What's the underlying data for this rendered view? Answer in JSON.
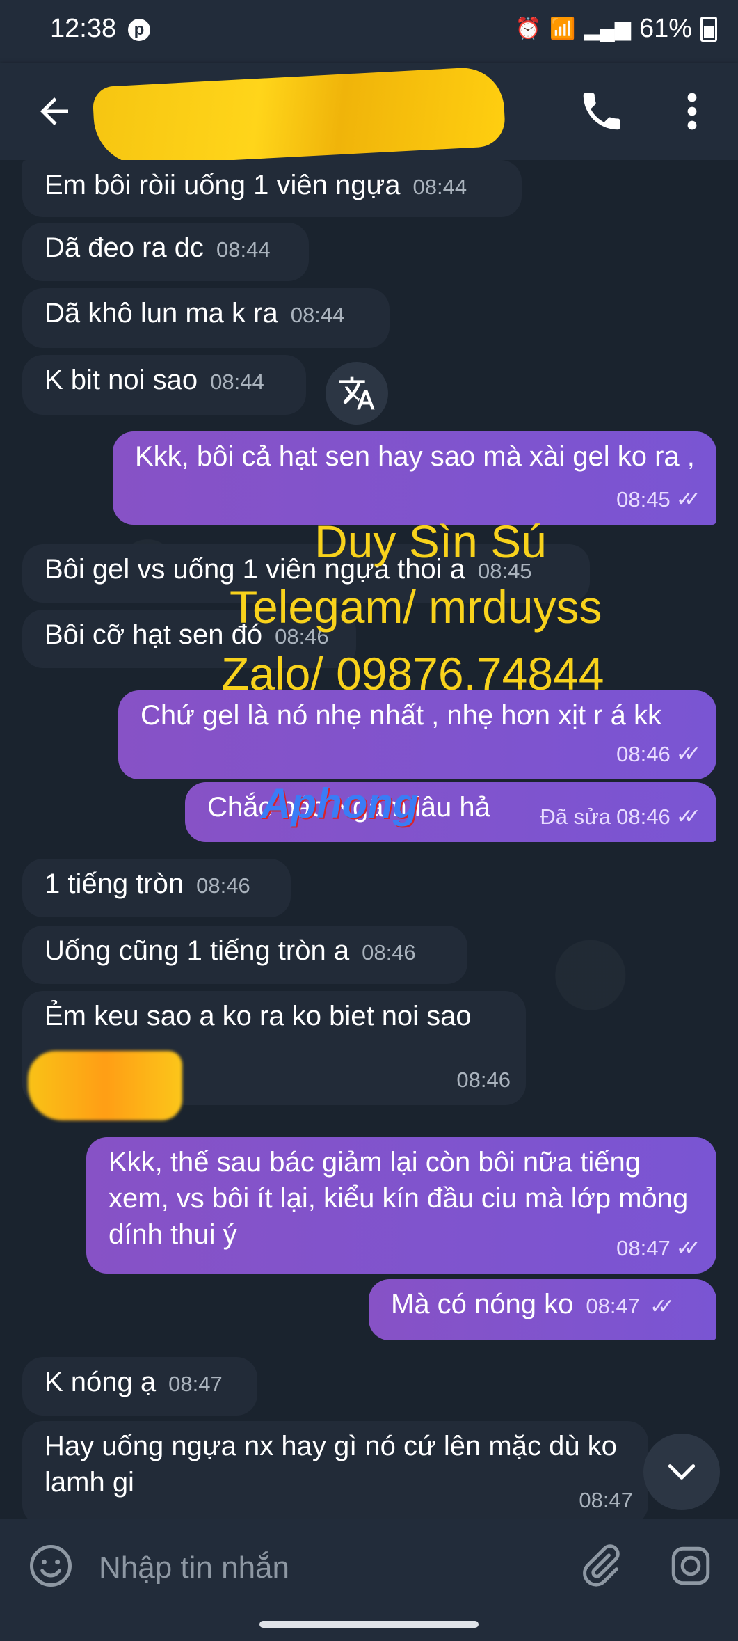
{
  "status_bar": {
    "time": "12:38",
    "battery": "61%"
  },
  "header": {
    "contact_name_redacted": true
  },
  "messages": [
    {
      "dir": "in",
      "text": "Em bôi ròii uống 1 viên ngựa",
      "time": "08:44"
    },
    {
      "dir": "in",
      "text": "Dã đeo ra dc",
      "time": "08:44"
    },
    {
      "dir": "in",
      "text": "Dã khô lun ma k ra",
      "time": "08:44"
    },
    {
      "dir": "in",
      "text": "K bit noi sao",
      "time": "08:44"
    },
    {
      "dir": "out",
      "text": "Kkk, bôi cả hạt sen hay sao mà xài gel ko ra ,",
      "time": "08:45"
    },
    {
      "dir": "in",
      "text": "Bôi gel vs uống 1 viên ngựa thoi a",
      "time": "08:45"
    },
    {
      "dir": "in",
      "text": "Bôi cỡ hạt sen đó",
      "time": "08:46"
    },
    {
      "dir": "out",
      "text": "Chứ gel là nó nhẹ nhất , nhẹ hơn xịt r á kk",
      "time": "08:46"
    },
    {
      "dir": "out",
      "text": "Chắc bác Ngâm lâu hả",
      "edited": "Đã sửa",
      "time": "08:46"
    },
    {
      "dir": "in",
      "text": "1 tiếng tròn",
      "time": "08:46"
    },
    {
      "dir": "in",
      "text": "Uống cũng 1 tiếng tròn a",
      "time": "08:46"
    },
    {
      "dir": "in",
      "text": "Ẻm keu sao a ko ra ko biet noi sao",
      "time": "08:46"
    },
    {
      "dir": "out",
      "text": "Kkk, thế sau bác giảm lại còn bôi nữa tiếng xem, vs bôi ít lại, kiểu kín đầu ciu mà lớp mỏng dính thui ý",
      "time": "08:47"
    },
    {
      "dir": "out",
      "text": "Mà có nóng ko",
      "time": "08:47"
    },
    {
      "dir": "in",
      "text": "K nóng ạ",
      "time": "08:47"
    },
    {
      "dir": "in",
      "text": "Hay uống ngựa nx hay gì nó cứ lên mặc dù ko lamh gi",
      "time": "08:47"
    }
  ],
  "watermark": {
    "line1": "Duy Sìn Sú",
    "line2": "Telegam/ mrduyss",
    "line3": "Zalo/ 09876.74844",
    "logo": "Aphong"
  },
  "input": {
    "placeholder": "Nhập tin nhắn"
  },
  "colors": {
    "outgoing": "#8752c6",
    "incoming": "#222b38",
    "watermark": "#f8d21c"
  }
}
